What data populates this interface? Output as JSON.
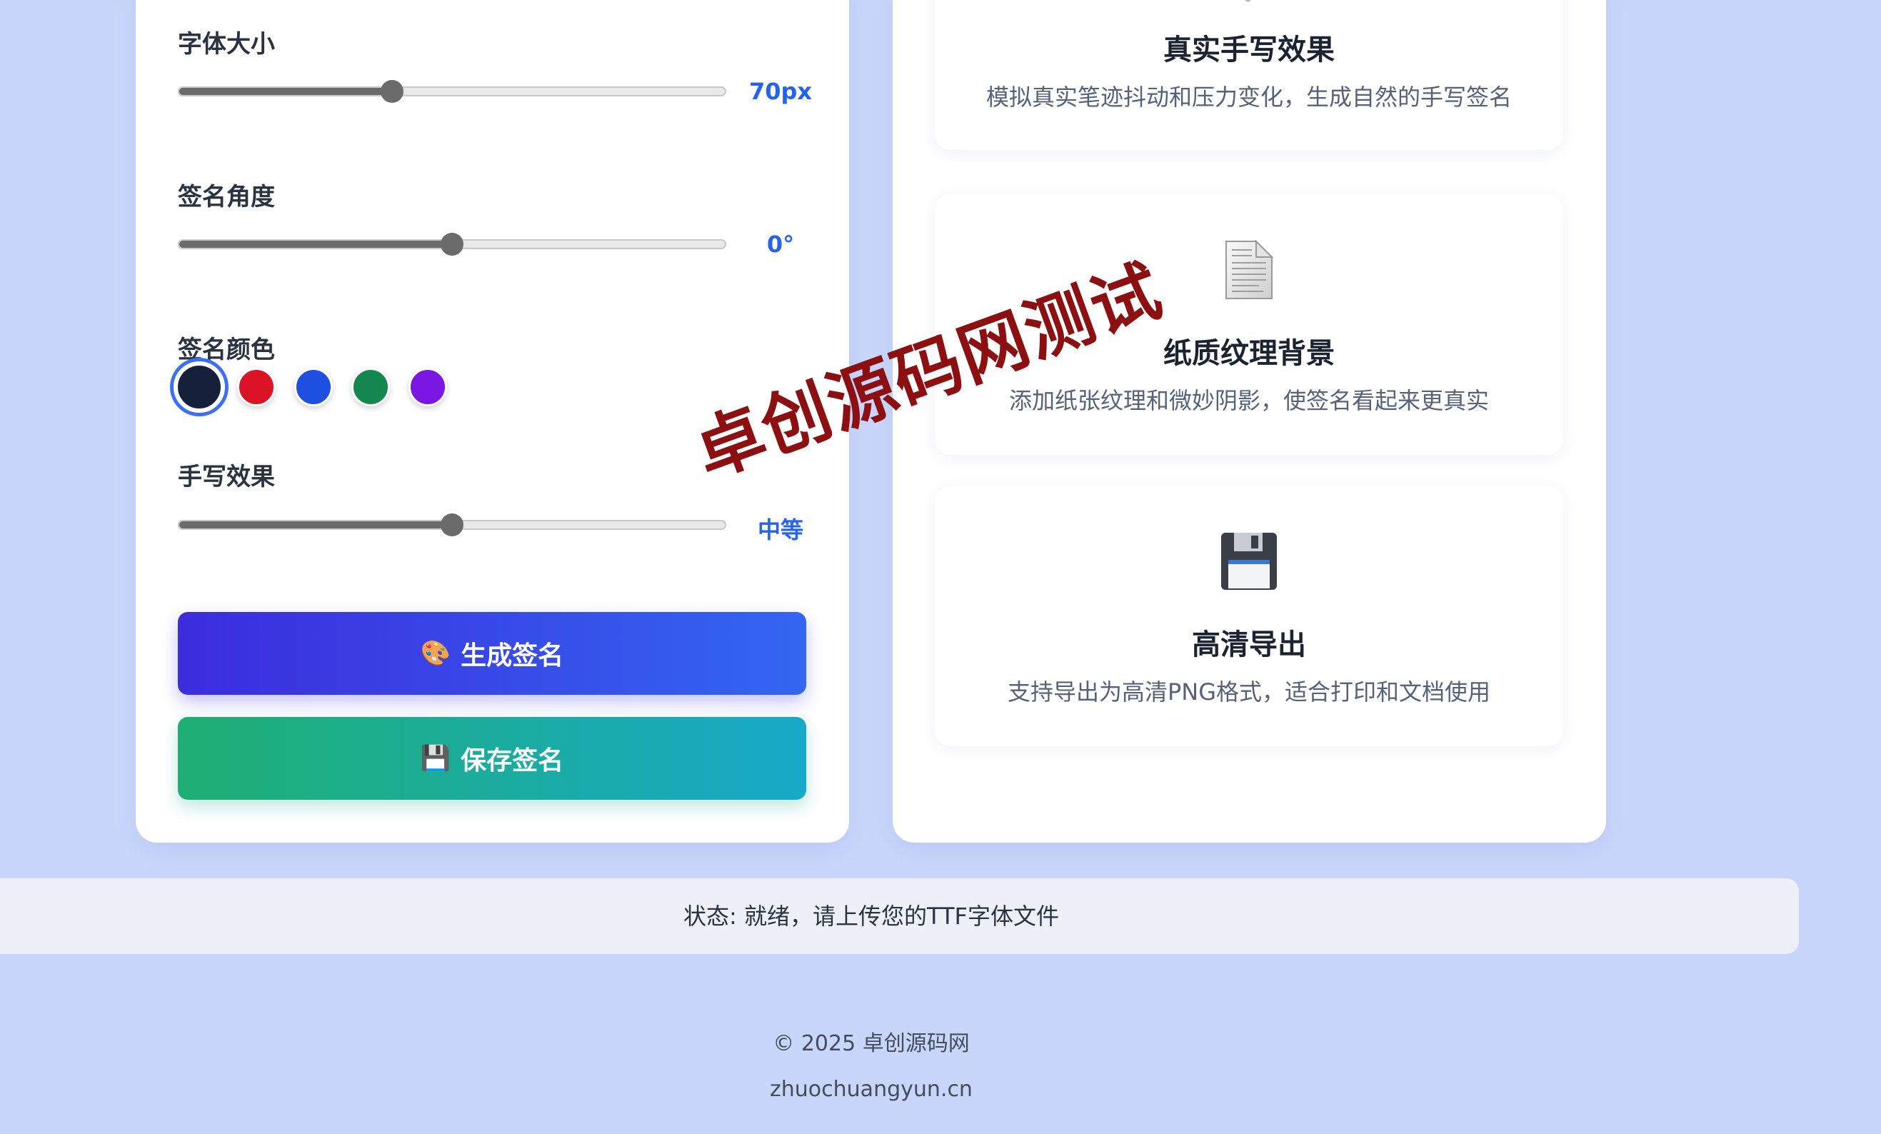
{
  "controls": {
    "font_size": {
      "label": "字体大小",
      "value_text": "70px",
      "level": 0.39
    },
    "angle": {
      "label": "签名角度",
      "value_text": "0°",
      "level": 0.5
    },
    "color": {
      "label": "签名颜色",
      "swatches": [
        "#17203a",
        "#dc1226",
        "#1f4fe0",
        "#13874f",
        "#7a17e2"
      ],
      "selected": "#17203a"
    },
    "handwriting": {
      "label": "手写效果",
      "value_text": "中等",
      "level": 0.5
    }
  },
  "buttons": {
    "generate": {
      "icon": "🎨",
      "label": "生成签名"
    },
    "save": {
      "icon": "💾",
      "label": "保存签名"
    }
  },
  "features": [
    {
      "icon": "pen-icon",
      "title": "真实手写效果",
      "desc": "模拟真实笔迹抖动和压力变化，生成自然的手写签名"
    },
    {
      "icon": "document-icon",
      "title": "纸质纹理背景",
      "desc": "添加纸张纹理和微妙阴影，使签名看起来更真实"
    },
    {
      "icon": "floppy-disk-icon",
      "title": "高清导出",
      "desc": "支持导出为高清PNG格式，适合打印和文档使用"
    }
  ],
  "status": {
    "text": "状态: 就绪，请上传您的TTF字体文件"
  },
  "footer": {
    "copyright": "© 2025 卓创源码网",
    "domain": "zhuochuangyun.cn"
  },
  "watermark": {
    "text": "卓创源码网测试"
  },
  "colors": {
    "accent": "#2563eb",
    "generate_gradient": [
      "#3c2cdd",
      "#3366f1"
    ],
    "save_gradient": [
      "#1eaf72",
      "#18a9c9"
    ],
    "watermark": "#8c0f12",
    "background": "#c9d6fb"
  }
}
